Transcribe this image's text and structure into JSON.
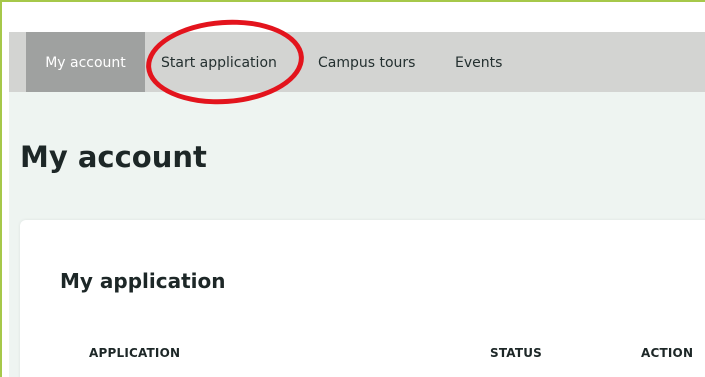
{
  "nav": {
    "items": [
      {
        "label": "My account",
        "active": true
      },
      {
        "label": "Start application",
        "active": false
      },
      {
        "label": "Campus tours",
        "active": false
      },
      {
        "label": "Events",
        "active": false
      }
    ]
  },
  "page": {
    "title": "My account"
  },
  "application_card": {
    "title": "My application",
    "columns": [
      "APPLICATION",
      "STATUS",
      "ACTION"
    ]
  },
  "colors": {
    "frame_border": "#a6c84a",
    "nav_bg": "#d3d4d2",
    "nav_active_bg": "#9fa1a0",
    "page_bg": "#eef4f1",
    "highlight": "#e3141d"
  }
}
